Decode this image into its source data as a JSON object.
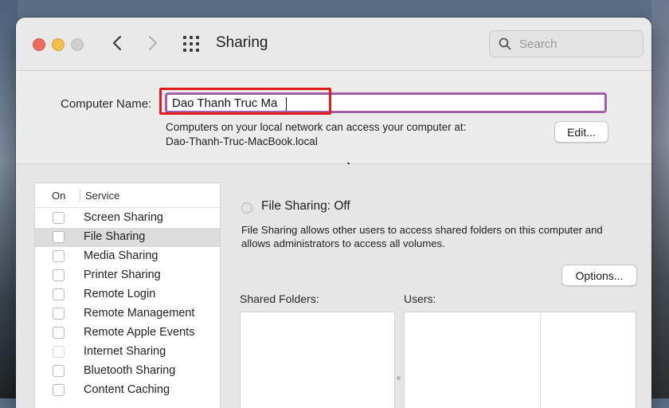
{
  "window": {
    "title": "Sharing"
  },
  "search": {
    "placeholder": "Search"
  },
  "computer_name": {
    "label": "Computer Name:",
    "value": "Dao Thanh Truc Ma",
    "description_line1": "Computers on your local network can access your computer at:",
    "description_line2": "Dao-Thanh-Truc-MacBook.local",
    "edit_label": "Edit..."
  },
  "services": {
    "header_on": "On",
    "header_service": "Service",
    "items": [
      {
        "label": "Screen Sharing",
        "checked": false
      },
      {
        "label": "File Sharing",
        "checked": false,
        "selected": true
      },
      {
        "label": "Media Sharing",
        "checked": false
      },
      {
        "label": "Printer Sharing",
        "checked": false
      },
      {
        "label": "Remote Login",
        "checked": false
      },
      {
        "label": "Remote Management",
        "checked": false
      },
      {
        "label": "Remote Apple Events",
        "checked": false
      },
      {
        "label": "Internet Sharing",
        "checked": false,
        "disabled": true
      },
      {
        "label": "Bluetooth Sharing",
        "checked": false
      },
      {
        "label": "Content Caching",
        "checked": false
      }
    ]
  },
  "detail": {
    "status": "File Sharing: Off",
    "description_line1": "File Sharing allows other users to access shared folders on this computer and",
    "description_line2": "allows administrators to access all volumes.",
    "options_label": "Options...",
    "shared_folders_label": "Shared Folders:",
    "users_label": "Users:"
  },
  "colors": {
    "highlight": "#e11b1b",
    "focus_ring": "#a05fa6"
  }
}
